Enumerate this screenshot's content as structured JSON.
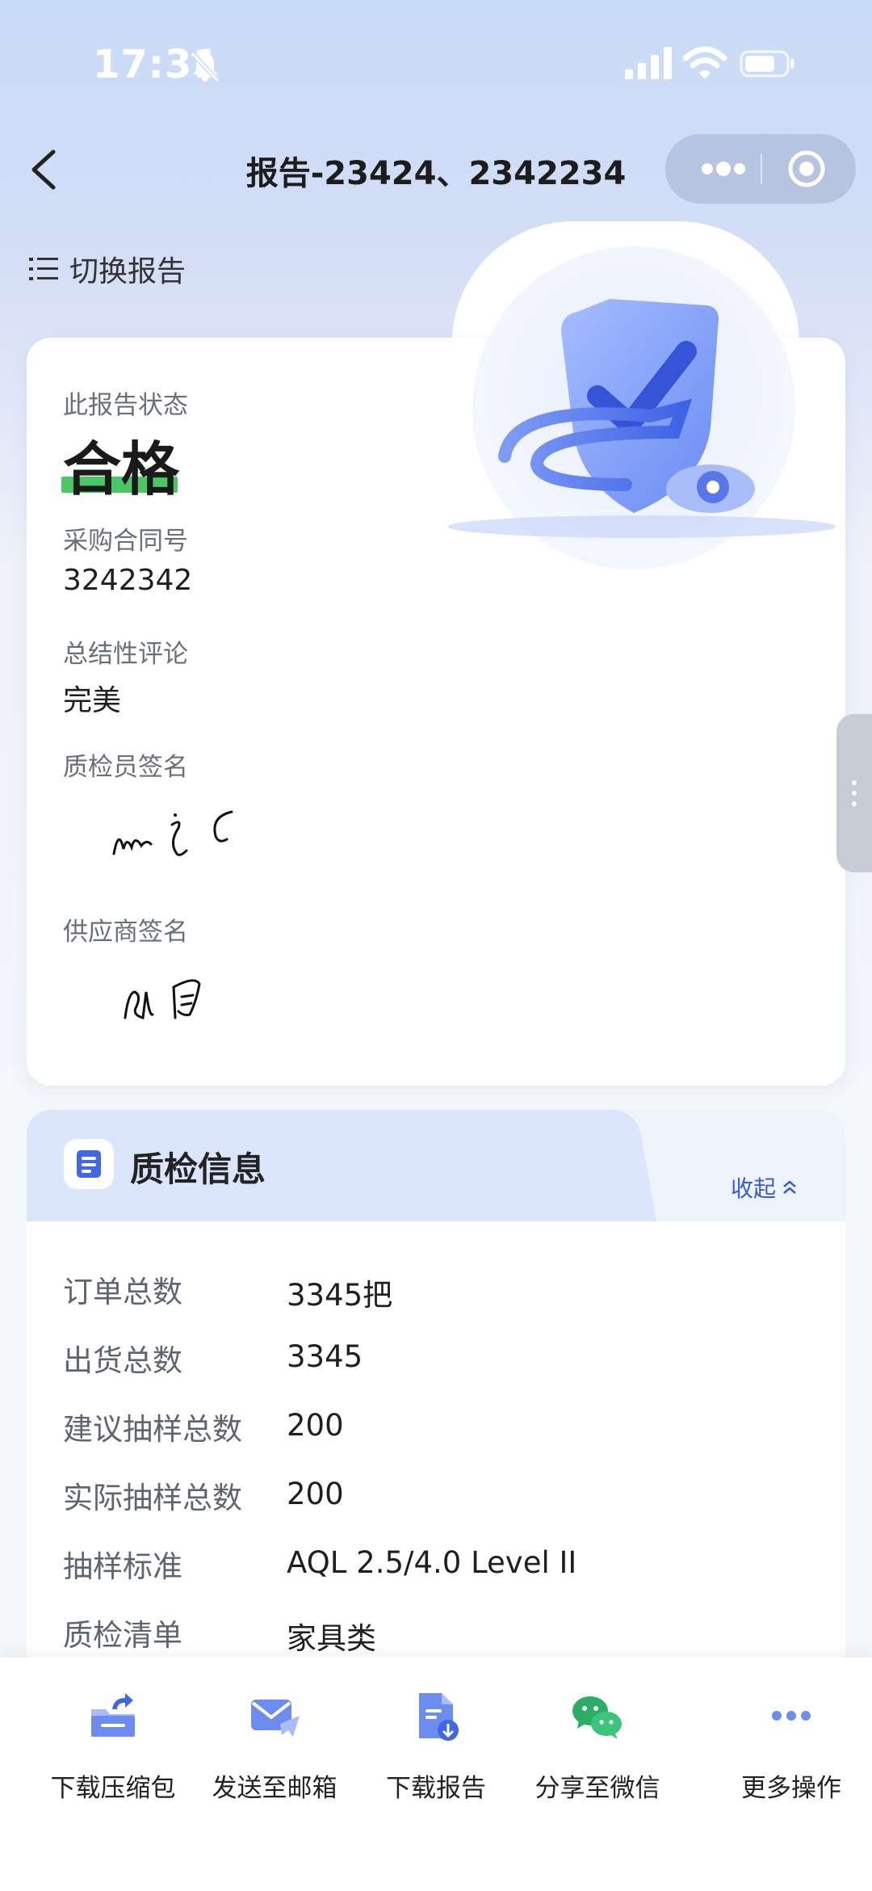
{
  "status_bar": {
    "time": "17:31"
  },
  "nav": {
    "title": "报告-23424、2342234"
  },
  "switch_report": {
    "label": "切换报告"
  },
  "report": {
    "status_label": "此报告状态",
    "status_value": "合格",
    "contract_label": "采购合同号",
    "contract_value": "3242342",
    "summary_label": "总结性评论",
    "summary_value": "完美",
    "inspector_sig_label": "质检员签名",
    "supplier_sig_label": "供应商签名"
  },
  "qc_info": {
    "title": "质检信息",
    "collapse_label": "收起",
    "rows": [
      {
        "key": "订单总数",
        "value": "3345把"
      },
      {
        "key": "出货总数",
        "value": "3345"
      },
      {
        "key": "建议抽样总数",
        "value": "200"
      },
      {
        "key": "实际抽样总数",
        "value": "200"
      },
      {
        "key": "抽样标准",
        "value": "AQL 2.5/4.0 Level II"
      },
      {
        "key": "质检清单",
        "value": "家具类"
      }
    ]
  },
  "actions": [
    {
      "label": "下载压缩包",
      "icon": "download-package-icon"
    },
    {
      "label": "发送至邮箱",
      "icon": "mail-send-icon"
    },
    {
      "label": "下载报告",
      "icon": "download-report-icon"
    },
    {
      "label": "分享至微信",
      "icon": "wechat-icon"
    },
    {
      "label": "更多操作",
      "icon": "more-dots-icon"
    }
  ],
  "colors": {
    "accent": "#3a5bd9",
    "pass_green": "#4cc566",
    "wechat_green": "#2aae67"
  }
}
